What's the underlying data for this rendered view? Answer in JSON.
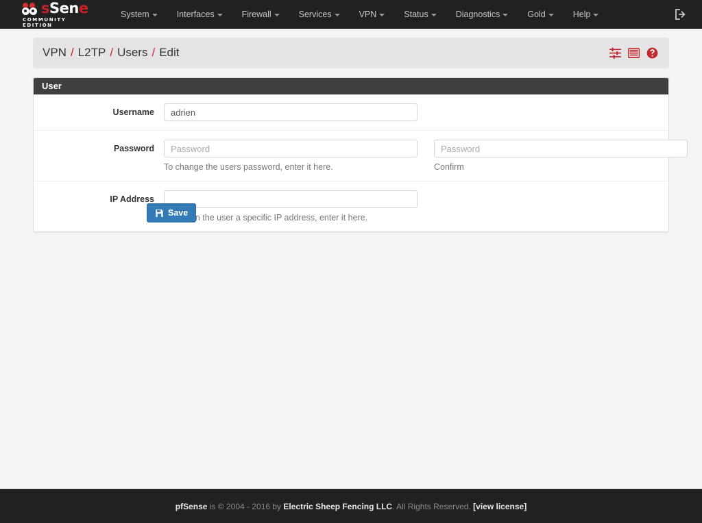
{
  "navbar": {
    "brand": {
      "word_part1": "Sen",
      "word_mid": "s",
      "word_part2": "e",
      "subtitle": "COMMUNITY EDITION"
    },
    "items": [
      {
        "label": "System",
        "has_caret": true
      },
      {
        "label": "Interfaces",
        "has_caret": true
      },
      {
        "label": "Firewall",
        "has_caret": true
      },
      {
        "label": "Services",
        "has_caret": true
      },
      {
        "label": "VPN",
        "has_caret": true
      },
      {
        "label": "Status",
        "has_caret": true
      },
      {
        "label": "Diagnostics",
        "has_caret": true
      },
      {
        "label": "Gold",
        "has_caret": true
      },
      {
        "label": "Help",
        "has_caret": true
      }
    ],
    "logout_icon": "logout-icon"
  },
  "breadcrumb": {
    "items": [
      "VPN",
      "L2TP",
      "Users",
      "Edit"
    ],
    "separator": "/",
    "icons": [
      "sliders-icon",
      "columns-icon",
      "help-circle-icon"
    ],
    "accent_color": "#cc2027"
  },
  "panel": {
    "title": "User",
    "rows": {
      "username": {
        "label": "Username",
        "value": "adrien",
        "placeholder": ""
      },
      "password": {
        "label": "Password",
        "value": "",
        "placeholder": "Password",
        "help": "To change the users password, enter it here.",
        "confirm_value": "",
        "confirm_placeholder": "Password",
        "confirm_help": "Confirm"
      },
      "ipaddress": {
        "label": "IP Address",
        "value": "",
        "placeholder": "",
        "help": "To assign the user a specific IP address, enter it here."
      }
    }
  },
  "actions": {
    "save_label": "Save",
    "save_icon": "floppy-disk-icon",
    "save_color": "#337ab7"
  },
  "footer": {
    "brand": "pfSense",
    "mid": " is © 2004 - 2016 by ",
    "company": "Electric Sheep Fencing LLC",
    "rights": ". All Rights Reserved. ",
    "license_open": "[",
    "license": "view license",
    "license_close": "]"
  }
}
